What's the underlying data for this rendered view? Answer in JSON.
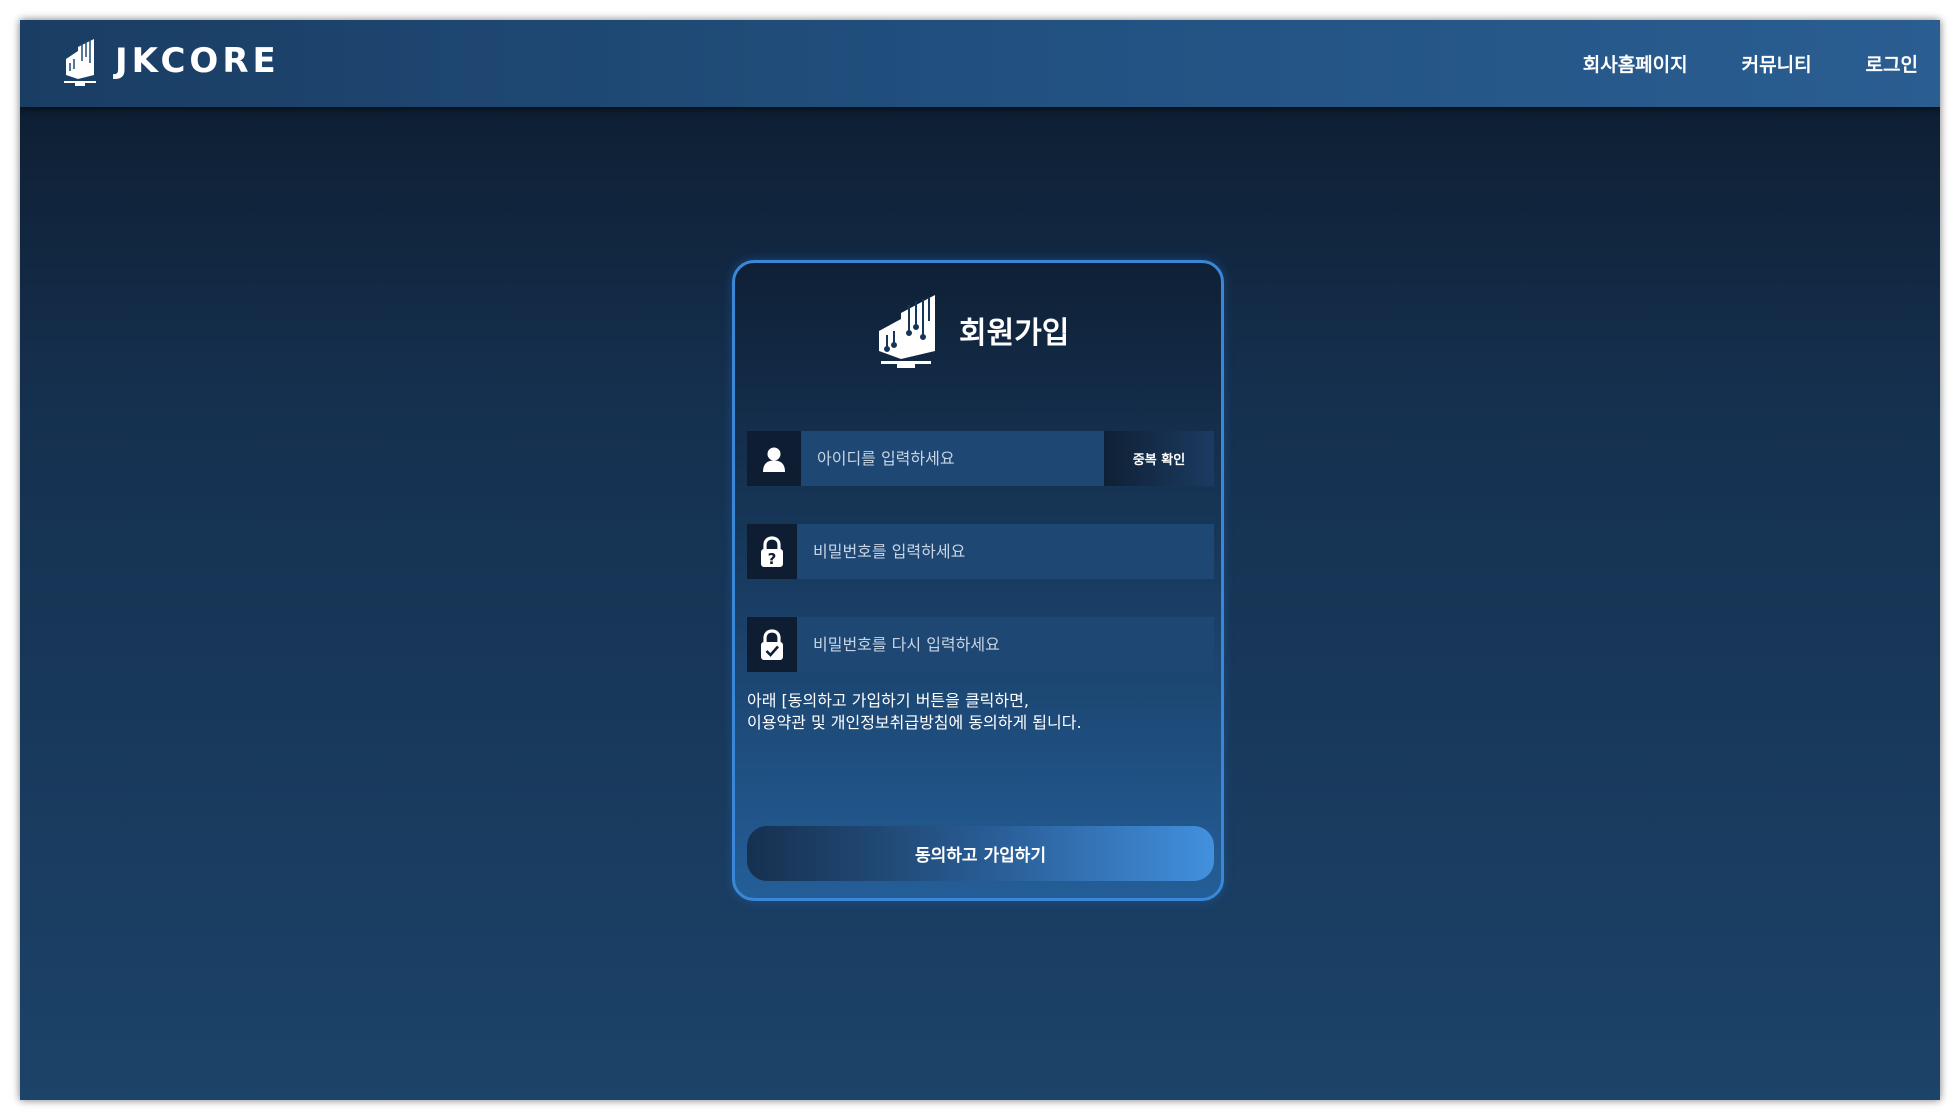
{
  "header": {
    "logo_text": "JKCORE",
    "nav": [
      "회사홈페이지",
      "커뮤니티",
      "로그인"
    ]
  },
  "signup": {
    "title": "회원가입",
    "id_placeholder": "아이디를 입력하세요",
    "dup_check_label": "중복 확인",
    "pw_placeholder": "비밀번호를 입력하세요",
    "pw_confirm_placeholder": "비밀번호를 다시 입력하세요",
    "notice_line1": "아래 [동의하고 가입하기 버튼을 클릭하면,",
    "notice_line2": "이용약관 및 개인정보취급방침에 동의하게 됩니다.",
    "submit_label": "동의하고 가입하기"
  },
  "icons": {
    "logo": "building-logo-icon",
    "id_field": "user-icon",
    "pw_field": "lock-question-icon",
    "pw_confirm_field": "lock-check-icon"
  },
  "colors": {
    "accent_border": "#3a87d8",
    "header": "#225282",
    "field_bg": "#1f4774",
    "icon_bg": "#0e1d31"
  }
}
